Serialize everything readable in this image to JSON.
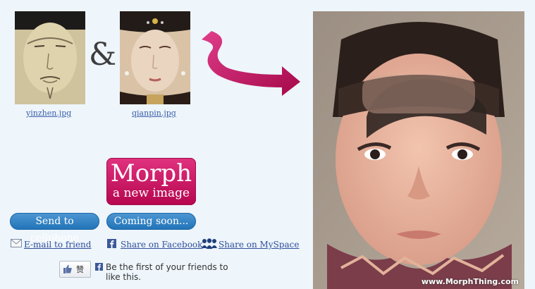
{
  "sources": [
    {
      "filename": "yinzhen.jpg"
    },
    {
      "filename": "qianpin.jpg"
    }
  ],
  "ampersand": "&",
  "morph_button": {
    "title": "Morph",
    "subtitle": "a new image"
  },
  "buttons": {
    "send_cellphone": "Send to cellphone",
    "coming_soon": "Coming soon..."
  },
  "share": {
    "email": "E-mail to friend",
    "facebook": "Share on Facebook",
    "myspace": "Share on MySpace"
  },
  "facebook_like": {
    "button_label": "赞",
    "text": "Be the first of your friends to like this."
  },
  "result": {
    "watermark": "www.MorphThing.com"
  },
  "colors": {
    "accent_pink": "#c8126a",
    "button_blue": "#2d7cbe",
    "background": "#eef5fb"
  }
}
